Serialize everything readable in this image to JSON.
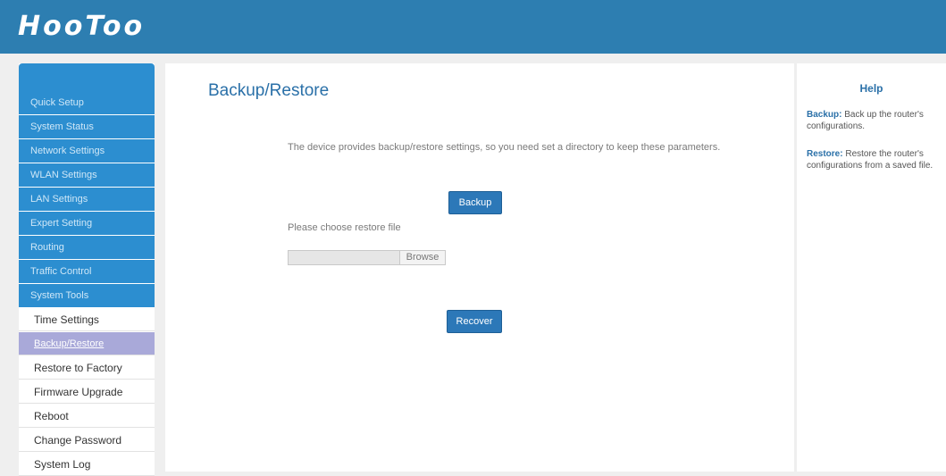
{
  "header": {
    "logo": "HooToo",
    "color": "#2d7eb1"
  },
  "sidebar": {
    "items": [
      {
        "label": "Quick Setup"
      },
      {
        "label": "System Status"
      },
      {
        "label": "Network Settings"
      },
      {
        "label": "WLAN Settings"
      },
      {
        "label": "LAN Settings"
      },
      {
        "label": "Expert Setting"
      },
      {
        "label": "Routing"
      },
      {
        "label": "Traffic Control"
      },
      {
        "label": "System Tools"
      }
    ],
    "subitems": [
      {
        "label": "Time Settings"
      },
      {
        "label": "Backup/Restore",
        "active": true
      },
      {
        "label": "Restore to Factory"
      },
      {
        "label": "Firmware Upgrade"
      },
      {
        "label": "Reboot"
      },
      {
        "label": "Change Password"
      },
      {
        "label": "System Log"
      }
    ]
  },
  "main": {
    "title": "Backup/Restore",
    "description": "The device provides backup/restore settings, so you need set a directory to keep these parameters.",
    "backup_label": "Backup",
    "restore_file_label": "Please choose restore file",
    "file_value": "",
    "browse_label": "Browse",
    "recover_label": "Recover"
  },
  "help": {
    "title": "Help",
    "backup_term": "Backup:",
    "backup_text": " Back up the router's configurations.",
    "restore_term": "Restore:",
    "restore_text": " Restore the router's configurations from a saved file."
  }
}
